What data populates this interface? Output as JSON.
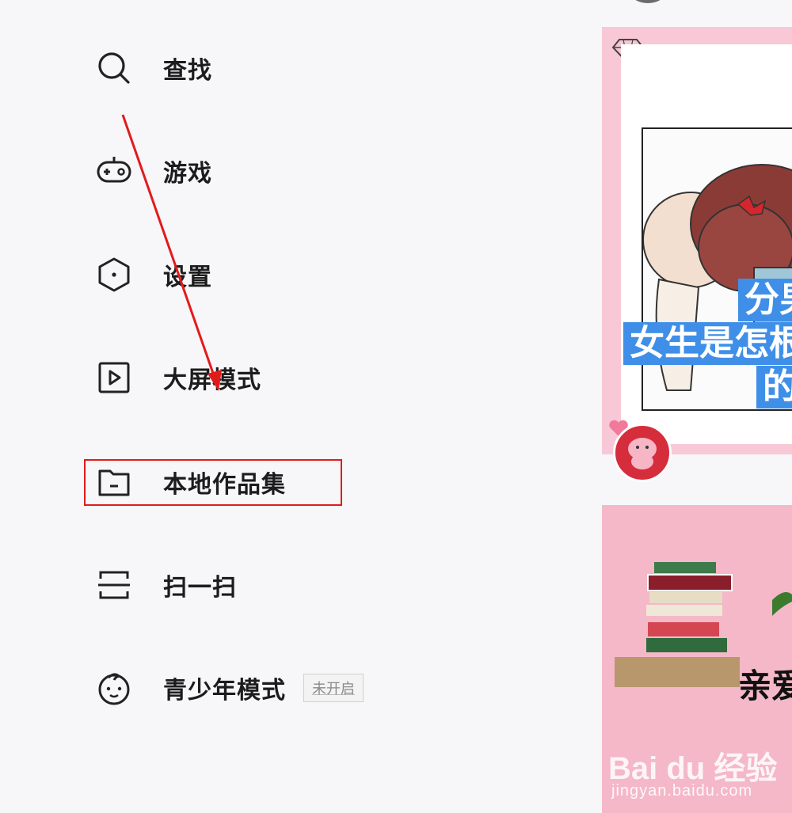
{
  "menu": {
    "items": [
      {
        "icon": "search-icon",
        "label": "查找"
      },
      {
        "icon": "gamepad-icon",
        "label": "游戏"
      },
      {
        "icon": "hexagon-settings-icon",
        "label": "设置"
      },
      {
        "icon": "play-screen-icon",
        "label": "大屏模式"
      },
      {
        "icon": "folder-icon",
        "label": "本地作品集"
      },
      {
        "icon": "scan-icon",
        "label": "扫一扫"
      },
      {
        "icon": "child-face-icon",
        "label": "青少年模式",
        "badge": "未开启"
      }
    ]
  },
  "annotations": {
    "highlight_color": "#e11b1b",
    "arrow_color": "#e11b1b"
  },
  "feed": {
    "card1_captions": [
      "分男",
      "女生是怎根",
      "的"
    ],
    "card2_text": "亲爱",
    "watermark": "Bai du 经验",
    "watermark_url": "jingyan.baidu.com"
  }
}
